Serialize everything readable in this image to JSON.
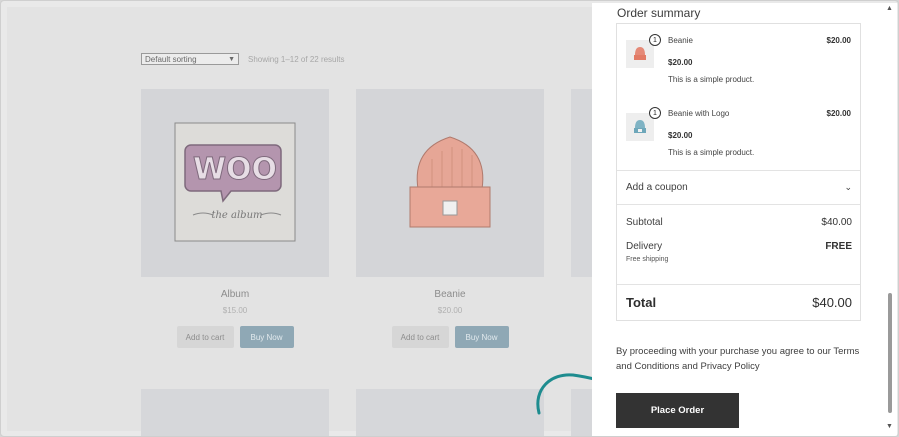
{
  "shop": {
    "sort_label": "Default sorting",
    "result_count": "Showing 1–12 of 22 results",
    "products": [
      {
        "name": "Album",
        "price": "$15.00",
        "add_label": "Add to cart",
        "buy_label": "Buy Now",
        "image_icon": "woo-album-art"
      },
      {
        "name": "Beanie",
        "price": "$20.00",
        "add_label": "Add to cart",
        "buy_label": "Buy Now",
        "image_icon": "beanie-hat"
      }
    ]
  },
  "summary": {
    "title": "Order summary",
    "items": [
      {
        "qty": "1",
        "name": "Beanie",
        "total": "$20.00",
        "price": "$20.00",
        "desc": "This is a simple product.",
        "icon": "beanie-icon",
        "color": "#e58a78"
      },
      {
        "qty": "1",
        "name": "Beanie with Logo",
        "total": "$20.00",
        "price": "$20.00",
        "desc": "This is a simple product.",
        "icon": "beanie-logo-icon",
        "color": "#7fb3c4"
      }
    ],
    "coupon_label": "Add a coupon",
    "subtotal_label": "Subtotal",
    "subtotal_value": "$40.00",
    "delivery_label": "Delivery",
    "delivery_value": "FREE",
    "delivery_note": "Free shipping",
    "total_label": "Total",
    "total_value": "$40.00"
  },
  "terms_text": "By proceeding with your purchase you agree to our Terms and Conditions and Privacy Policy",
  "place_order_label": "Place Order",
  "colors": {
    "accent_arrow": "#1e8c8f",
    "button": "#333333"
  }
}
